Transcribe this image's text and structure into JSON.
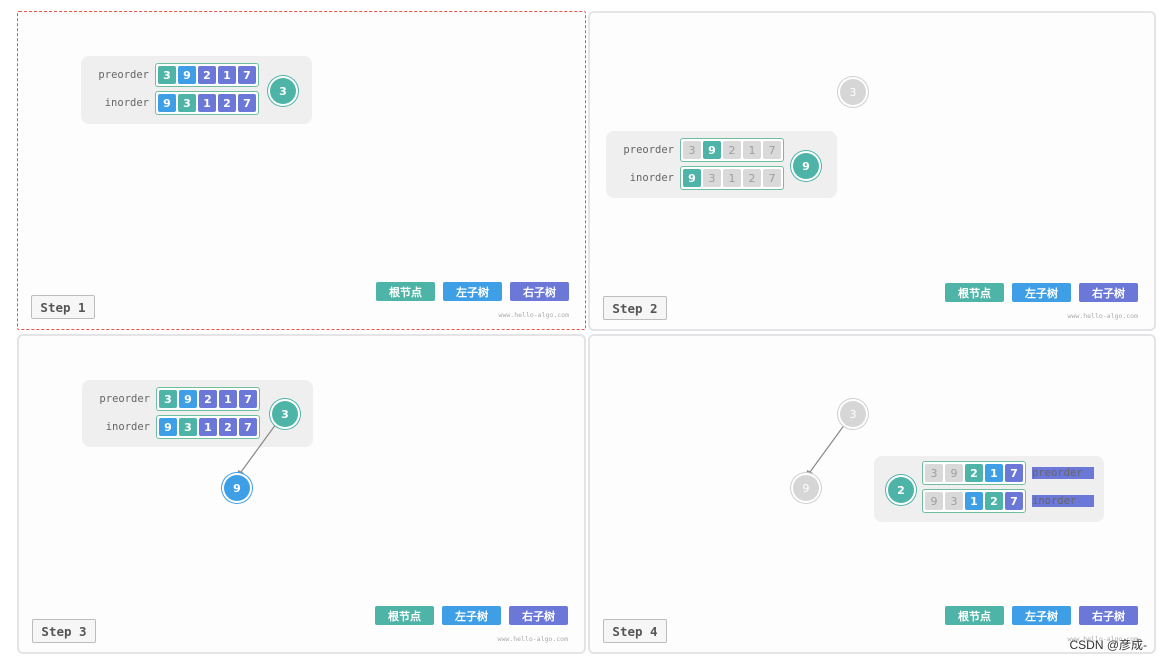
{
  "labels": {
    "preorder": "preorder",
    "inorder": "inorder"
  },
  "legend": {
    "root": "根节点",
    "left": "左子树",
    "right": "右子树"
  },
  "watermark": "www.hello-algo.com",
  "credit": "CSDN @彦成-",
  "panels": [
    {
      "step": "Step 1",
      "preorder": [
        {
          "v": "3",
          "role": "root"
        },
        {
          "v": "9",
          "role": "left"
        },
        {
          "v": "2",
          "role": "right"
        },
        {
          "v": "1",
          "role": "right"
        },
        {
          "v": "7",
          "role": "right"
        }
      ],
      "inorder": [
        {
          "v": "9",
          "role": "left"
        },
        {
          "v": "3",
          "role": "root"
        },
        {
          "v": "1",
          "role": "right"
        },
        {
          "v": "2",
          "role": "right"
        },
        {
          "v": "7",
          "role": "right"
        }
      ],
      "card_node": {
        "v": "3",
        "role": "root"
      },
      "tree_nodes": []
    },
    {
      "step": "Step 2",
      "preorder": [
        {
          "v": "3",
          "role": "gray"
        },
        {
          "v": "9",
          "role": "root"
        },
        {
          "v": "2",
          "role": "gray"
        },
        {
          "v": "1",
          "role": "gray"
        },
        {
          "v": "7",
          "role": "gray"
        }
      ],
      "inorder": [
        {
          "v": "9",
          "role": "root"
        },
        {
          "v": "3",
          "role": "gray"
        },
        {
          "v": "1",
          "role": "gray"
        },
        {
          "v": "2",
          "role": "gray"
        },
        {
          "v": "7",
          "role": "gray"
        }
      ],
      "card_node": {
        "v": "9",
        "role": "root"
      },
      "tree_nodes": [
        {
          "v": "3",
          "role": "gray"
        }
      ]
    },
    {
      "step": "Step 3",
      "preorder": [
        {
          "v": "3",
          "role": "root"
        },
        {
          "v": "9",
          "role": "left"
        },
        {
          "v": "2",
          "role": "right"
        },
        {
          "v": "1",
          "role": "right"
        },
        {
          "v": "7",
          "role": "right"
        }
      ],
      "inorder": [
        {
          "v": "9",
          "role": "left"
        },
        {
          "v": "3",
          "role": "root"
        },
        {
          "v": "1",
          "role": "right"
        },
        {
          "v": "2",
          "role": "right"
        },
        {
          "v": "7",
          "role": "right"
        }
      ],
      "card_node": {
        "v": "3",
        "role": "root"
      },
      "tree_nodes": [
        {
          "v": "9",
          "role": "left"
        }
      ]
    },
    {
      "step": "Step 4",
      "preorder": [
        {
          "v": "3",
          "role": "gray"
        },
        {
          "v": "9",
          "role": "gray"
        },
        {
          "v": "2",
          "role": "root"
        },
        {
          "v": "1",
          "role": "left"
        },
        {
          "v": "7",
          "role": "right"
        }
      ],
      "inorder": [
        {
          "v": "9",
          "role": "gray"
        },
        {
          "v": "3",
          "role": "gray"
        },
        {
          "v": "1",
          "role": "left"
        },
        {
          "v": "2",
          "role": "root"
        },
        {
          "v": "7",
          "role": "right"
        }
      ],
      "card_node": {
        "v": "2",
        "role": "root"
      },
      "tree_nodes": [
        {
          "v": "3",
          "role": "gray"
        },
        {
          "v": "9",
          "role": "gray"
        }
      ]
    }
  ]
}
